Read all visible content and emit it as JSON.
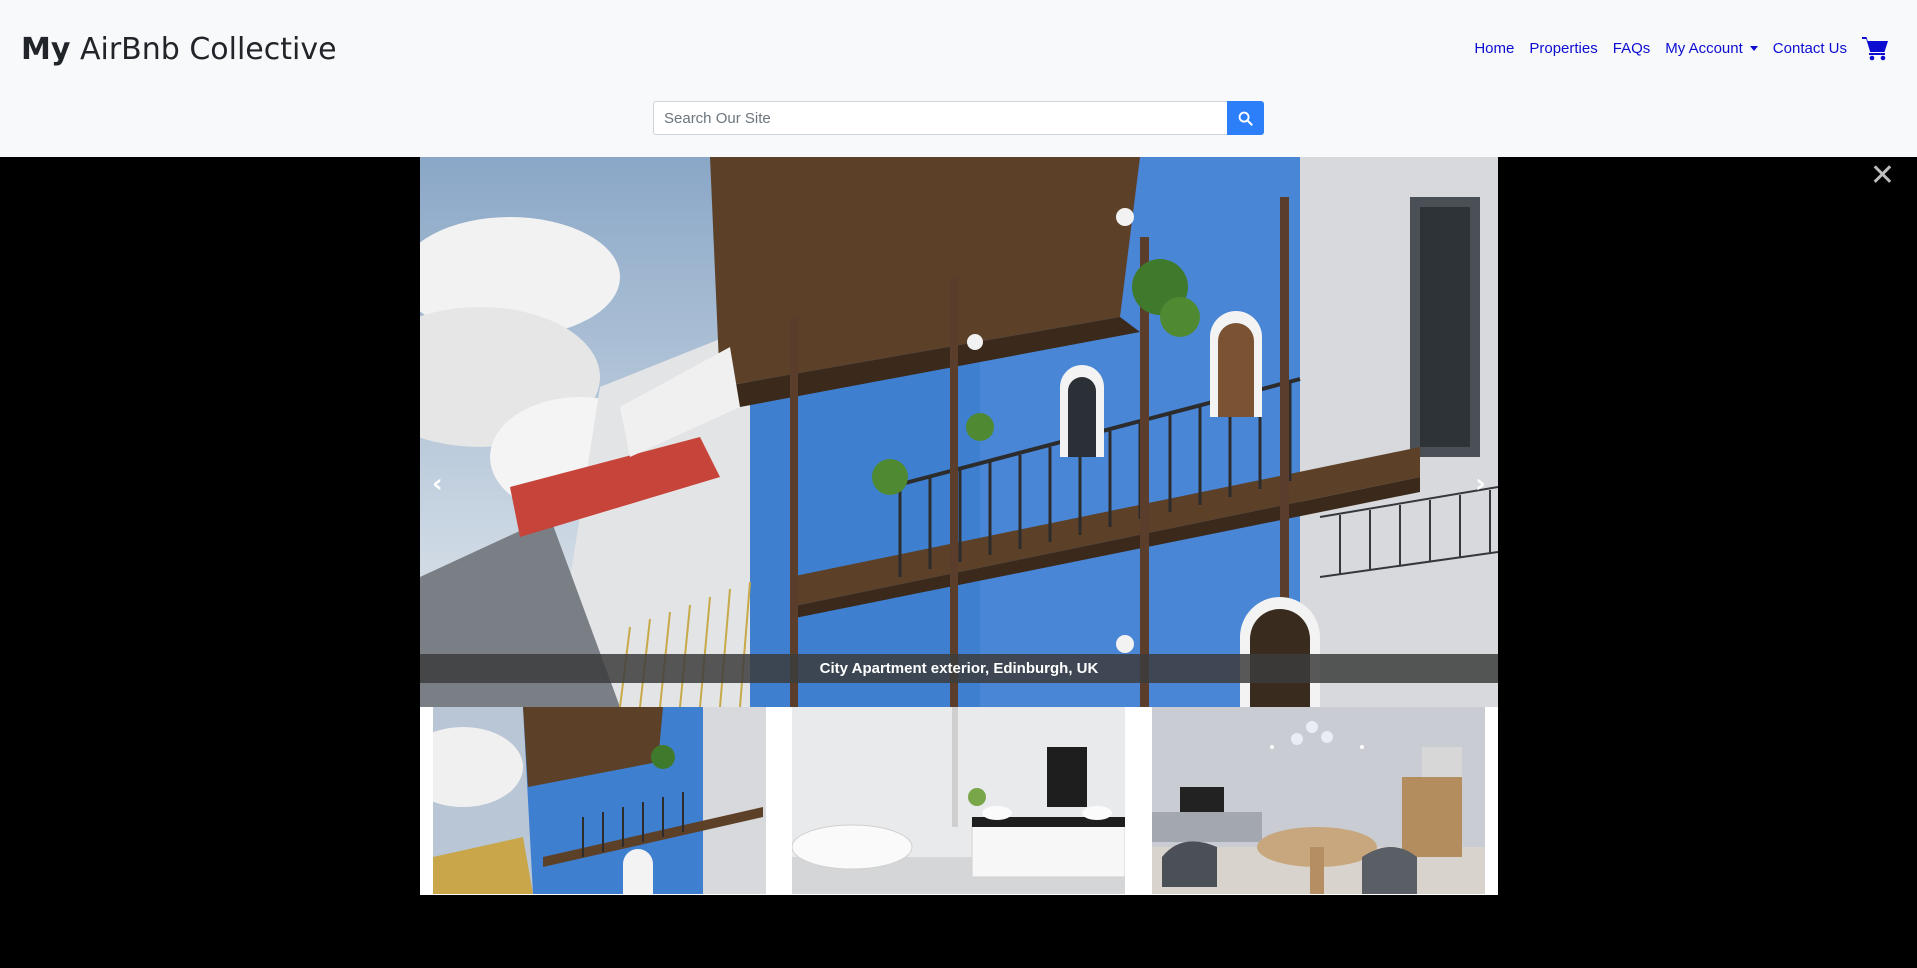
{
  "brand": {
    "bold": "My",
    "rest": " AirBnb Collective"
  },
  "nav": {
    "items": [
      "Home",
      "Properties",
      "FAQs",
      "My Account",
      "Contact Us"
    ],
    "cart_icon": "shopping-cart-icon"
  },
  "search": {
    "placeholder": "Search Our Site",
    "value": "",
    "icon": "search-icon"
  },
  "lightbox": {
    "caption": "City Apartment exterior, Edinburgh, UK",
    "prev_icon": "chevron-left-icon",
    "next_icon": "chevron-right-icon",
    "close_icon": "close-icon"
  },
  "colors": {
    "accent": "#2d7ff9",
    "link": "#0d0dd1",
    "header_bg": "#f8f9fa"
  }
}
